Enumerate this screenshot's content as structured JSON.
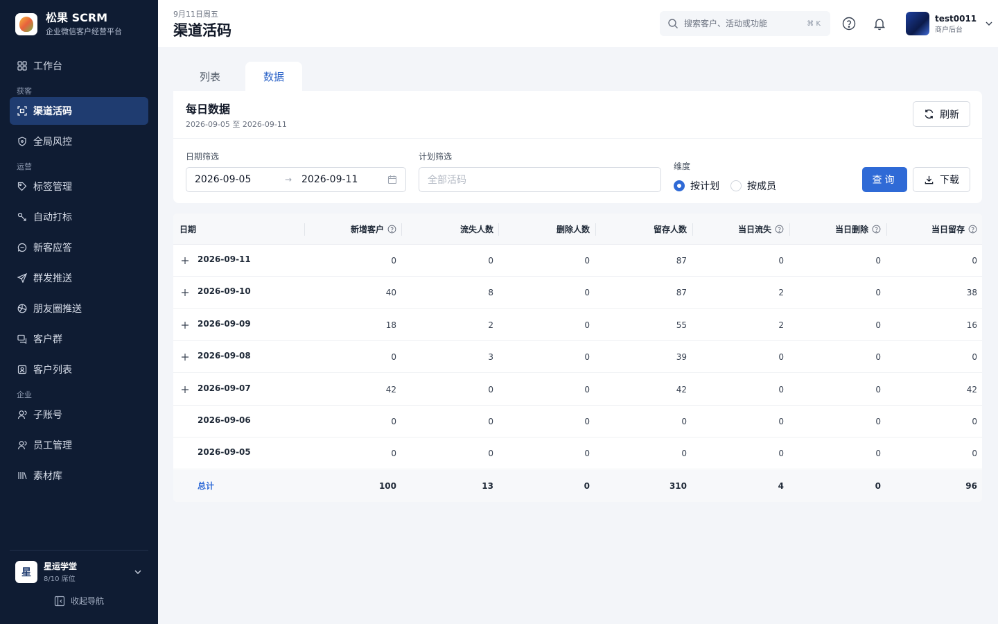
{
  "brand": {
    "name": "松果 SCRM",
    "subtitle": "企业微信客户经营平台"
  },
  "sidebar": {
    "groups": {
      "acquire": "获客",
      "operate": "运营",
      "enterprise": "企业"
    },
    "items": [
      {
        "label": "工作台",
        "icon": "grid-icon"
      },
      {
        "label": "渠道活码",
        "icon": "qr-scan-icon",
        "active": true
      },
      {
        "label": "全局风控",
        "icon": "shield-icon"
      },
      {
        "label": "标签管理",
        "icon": "tag-icon"
      },
      {
        "label": "自动打标",
        "icon": "auto-tag-icon"
      },
      {
        "label": "新客应答",
        "icon": "chat-reply-icon"
      },
      {
        "label": "群发推送",
        "icon": "send-icon"
      },
      {
        "label": "朋友圈推送",
        "icon": "aperture-icon"
      },
      {
        "label": "客户群",
        "icon": "group-chat-icon"
      },
      {
        "label": "客户列表",
        "icon": "contact-card-icon"
      },
      {
        "label": "子账号",
        "icon": "user-icon"
      },
      {
        "label": "员工管理",
        "icon": "staff-icon"
      },
      {
        "label": "素材库",
        "icon": "library-icon"
      }
    ],
    "org": {
      "avatar": "星",
      "name": "星运学堂",
      "seats": "8/10 席位"
    },
    "collapse_label": "收起导航"
  },
  "header": {
    "date": "9月11日周五",
    "title": "渠道活码",
    "search_placeholder": "搜索客户、活动或功能",
    "search_shortcut": "⌘ K",
    "user": {
      "name": "test0011",
      "role": "商户后台"
    }
  },
  "tabs": [
    {
      "label": "列表"
    },
    {
      "label": "数据",
      "active": true
    }
  ],
  "daily": {
    "title": "每日数据",
    "range": "2026-09-05 至 2026-09-11",
    "refresh_label": "刷新",
    "date_filter_label": "日期筛选",
    "date_start": "2026-09-05",
    "date_end": "2026-09-11",
    "date_arrow": "→",
    "plan_filter_label": "计划筛选",
    "plan_placeholder": "全部活码",
    "dimension_label": "维度",
    "dimension_options": [
      {
        "label": "按计划",
        "selected": true
      },
      {
        "label": "按成员",
        "selected": false
      }
    ],
    "query_label": "查询",
    "download_label": "下载"
  },
  "table": {
    "columns": [
      "日期",
      "新增客户",
      "流失人数",
      "删除人数",
      "留存人数",
      "当日流失",
      "当日删除",
      "当日留存"
    ],
    "help_columns": [
      1,
      5,
      6,
      7
    ],
    "rows": [
      {
        "date": "2026-09-11",
        "expandable": true,
        "values": [
          "0",
          "0",
          "0",
          "87",
          "0",
          "0",
          "0"
        ]
      },
      {
        "date": "2026-09-10",
        "expandable": true,
        "values": [
          "40",
          "8",
          "0",
          "87",
          "2",
          "0",
          "38"
        ]
      },
      {
        "date": "2026-09-09",
        "expandable": true,
        "values": [
          "18",
          "2",
          "0",
          "55",
          "2",
          "0",
          "16"
        ]
      },
      {
        "date": "2026-09-08",
        "expandable": true,
        "values": [
          "0",
          "3",
          "0",
          "39",
          "0",
          "0",
          "0"
        ]
      },
      {
        "date": "2026-09-07",
        "expandable": true,
        "values": [
          "42",
          "0",
          "0",
          "42",
          "0",
          "0",
          "42"
        ]
      },
      {
        "date": "2026-09-06",
        "expandable": false,
        "values": [
          "0",
          "0",
          "0",
          "0",
          "0",
          "0",
          "0"
        ]
      },
      {
        "date": "2026-09-05",
        "expandable": false,
        "values": [
          "0",
          "0",
          "0",
          "0",
          "0",
          "0",
          "0"
        ]
      }
    ],
    "total": {
      "label": "总计",
      "values": [
        "100",
        "13",
        "0",
        "310",
        "4",
        "0",
        "96"
      ]
    }
  },
  "colors": {
    "sidebar_bg": "#0f1c33",
    "active_nav": "#1f3c70",
    "accent": "#2f6ad6"
  }
}
